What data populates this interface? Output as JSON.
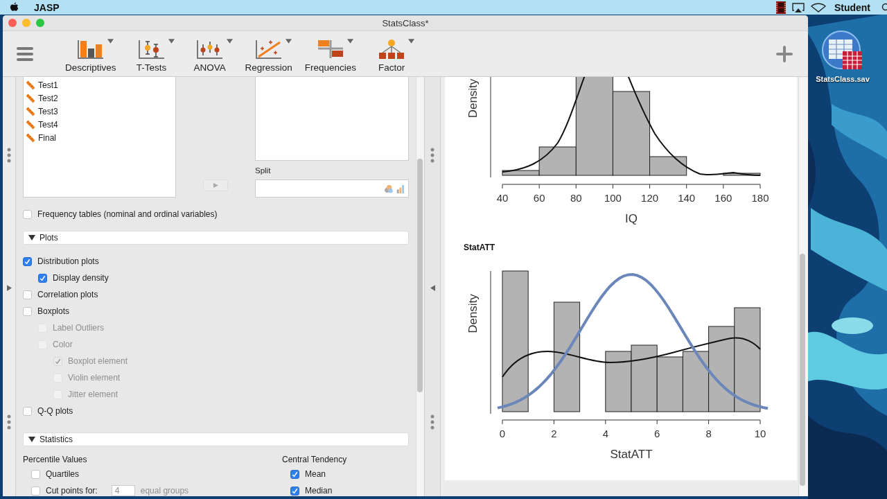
{
  "menubar": {
    "app_name": "JASP",
    "user": "Student"
  },
  "window": {
    "title": "StatsClass*"
  },
  "toolbar": {
    "tools": [
      {
        "label": "Descriptives",
        "kind": "descriptives"
      },
      {
        "label": "T-Tests",
        "kind": "ttests"
      },
      {
        "label": "ANOVA",
        "kind": "anova"
      },
      {
        "label": "Regression",
        "kind": "regression"
      },
      {
        "label": "Frequencies",
        "kind": "frequencies"
      },
      {
        "label": "Factor",
        "kind": "factor"
      }
    ]
  },
  "variables": [
    {
      "name": "Test1"
    },
    {
      "name": "Test2"
    },
    {
      "name": "Test3"
    },
    {
      "name": "Test4"
    },
    {
      "name": "Final"
    }
  ],
  "split": {
    "label": "Split"
  },
  "frequency_tables": {
    "label": "Frequency tables (nominal and ordinal variables)",
    "checked": false,
    "disabled": false
  },
  "plots_section": {
    "title": "Plots",
    "expanded": true,
    "options": [
      {
        "label": "Distribution plots",
        "checked": true,
        "disabled": false,
        "children": [
          {
            "label": "Display density",
            "checked": true,
            "disabled": false
          }
        ]
      },
      {
        "label": "Correlation plots",
        "checked": false,
        "disabled": false
      },
      {
        "label": "Boxplots",
        "checked": false,
        "disabled": false,
        "children": [
          {
            "label": "Label Outliers",
            "checked": false,
            "disabled": true
          },
          {
            "label": "Color",
            "checked": false,
            "disabled": true,
            "children": [
              {
                "label": "Boxplot element",
                "checked": true,
                "disabled": true
              },
              {
                "label": "Violin element",
                "checked": false,
                "disabled": true
              },
              {
                "label": "Jitter element",
                "checked": false,
                "disabled": true
              }
            ]
          }
        ]
      },
      {
        "label": "Q-Q plots",
        "checked": false,
        "disabled": false
      }
    ]
  },
  "statistics_section": {
    "title": "Statistics",
    "expanded": true,
    "groups": [
      {
        "title": "Percentile Values",
        "options": [
          {
            "kind": "checkbox",
            "label": "Quartiles",
            "checked": false
          },
          {
            "kind": "cutpoints",
            "label": "Cut points for:",
            "value": "4",
            "suffix": "equal groups",
            "checked": false
          }
        ]
      },
      {
        "title": "Central Tendency",
        "options": [
          {
            "kind": "checkbox",
            "label": "Mean",
            "checked": true
          },
          {
            "kind": "checkbox",
            "label": "Median",
            "checked": true
          }
        ]
      }
    ]
  },
  "results": {
    "plots": [
      {
        "ylabel": "Density",
        "xlabel": "IQ",
        "xticks": [
          "40",
          "60",
          "80",
          "100",
          "120",
          "140",
          "160",
          "180"
        ]
      },
      {
        "title": "StatATT",
        "ylabel": "Density",
        "xlabel": "StatATT",
        "xticks": [
          "0",
          "2",
          "4",
          "6",
          "8",
          "10"
        ]
      }
    ]
  },
  "desktop": {
    "icons": [
      {
        "label": "StatsClass.sav"
      }
    ]
  }
}
